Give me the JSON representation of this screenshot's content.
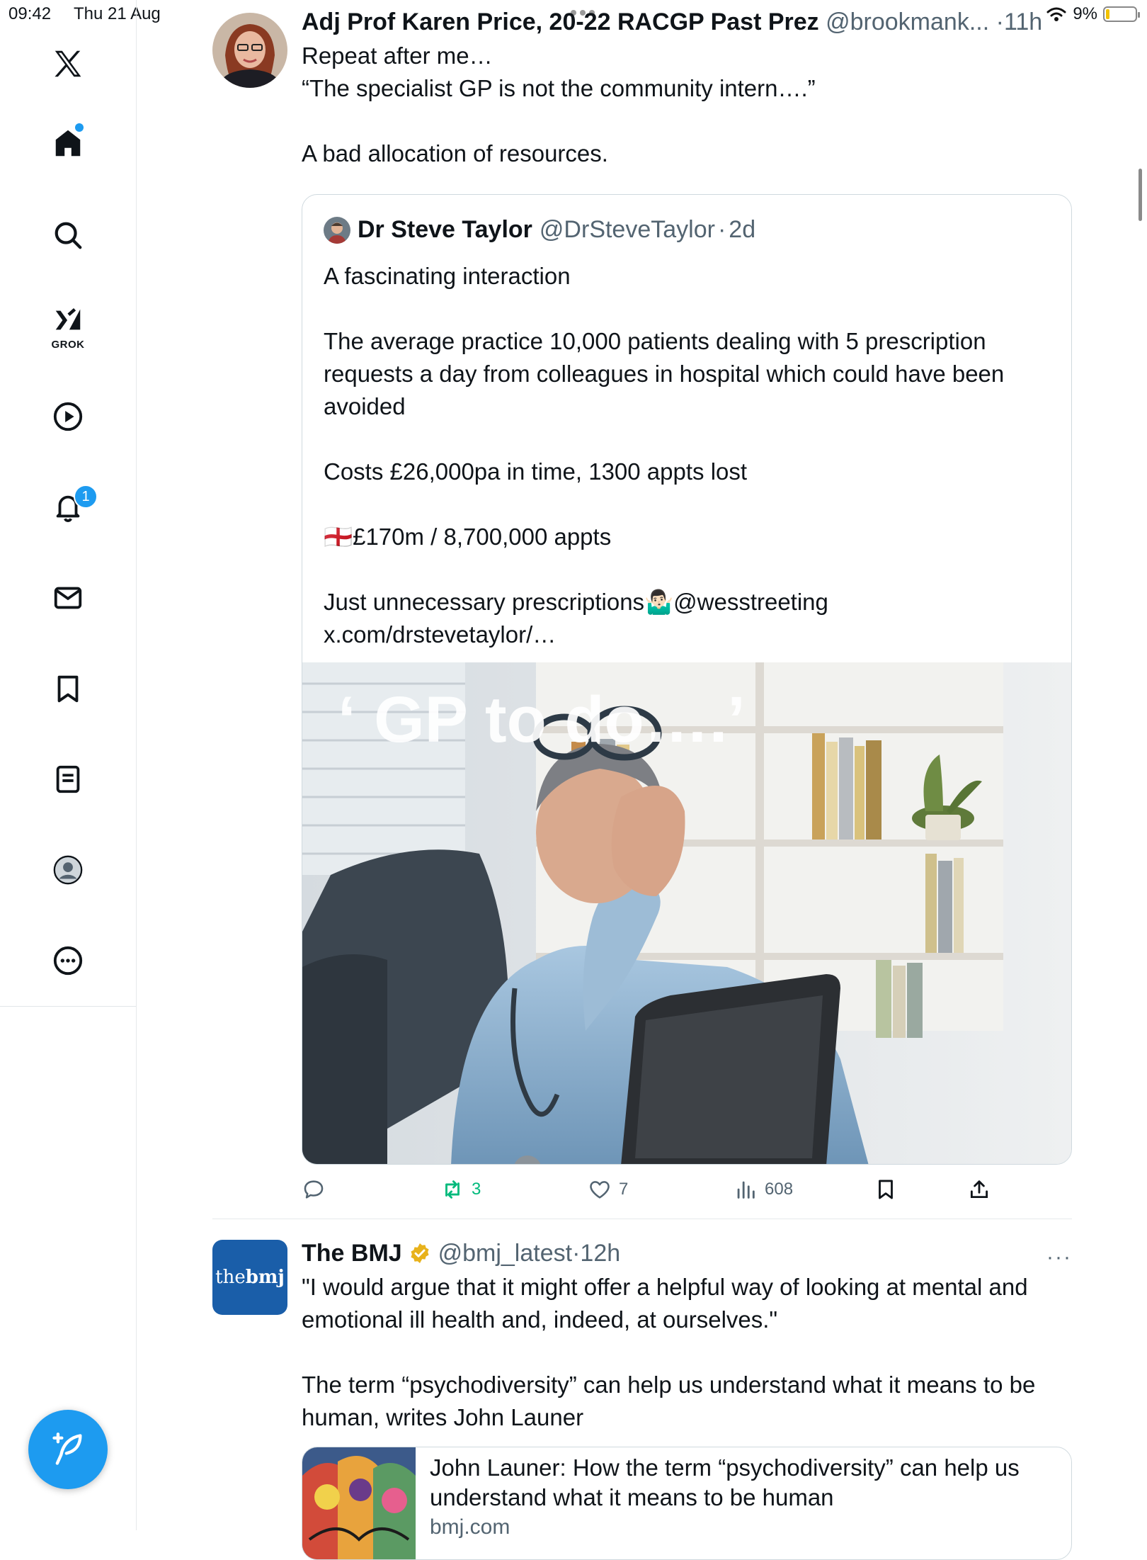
{
  "status_bar": {
    "time": "09:42",
    "date": "Thu 21 Aug",
    "battery": "9%"
  },
  "sidebar": {
    "items": [
      {
        "name": "home",
        "icon": "home-icon"
      },
      {
        "name": "search",
        "icon": "search-icon"
      },
      {
        "name": "grok",
        "icon": "grok-icon",
        "label": "GROK"
      },
      {
        "name": "video",
        "icon": "play-icon"
      },
      {
        "name": "notifications",
        "icon": "bell-icon",
        "badge": "1"
      },
      {
        "name": "messages",
        "icon": "mail-icon"
      },
      {
        "name": "bookmarks",
        "icon": "bookmark-icon"
      },
      {
        "name": "lists",
        "icon": "list-icon"
      },
      {
        "name": "profile",
        "icon": "profile-icon"
      },
      {
        "name": "more",
        "icon": "more-icon"
      }
    ],
    "compose_icon": "compose-icon",
    "accent": "#1d9bf0"
  },
  "tweet1": {
    "name": "Adj Prof Karen Price, 20-22 RACGP Past Prez",
    "handle": "@brookmank...",
    "sep": "·",
    "time": "11h",
    "text": "Repeat after me…\n“The specialist GP is not the community intern….”\n\nA bad allocation of resources.",
    "quote": {
      "name": "Dr Steve Taylor",
      "handle": "@DrSteveTaylor",
      "sep": "·",
      "time": "2d",
      "text": "A fascinating interaction\n\nThe average practice 10,000 patients dealing with 5 prescription requests a day from colleagues in hospital which could have been avoided\n\nCosts £26,000pa in time, 1300 appts lost\n\n🏴󠁧󠁢󠁥󠁮󠁧󠁿£170m / 8,700,000 appts\n\nJust unnecessary prescriptions🤷🏻‍♂️@wesstreeting x.com/drstevetaylor/…",
      "image_caption": "‘ GP to do….’"
    },
    "actions": {
      "reply": "",
      "retweets": "3",
      "likes": "7",
      "views": "608"
    },
    "retweet_color": "#00ba7c"
  },
  "tweet2": {
    "name": "The BMJ",
    "handle": "@bmj_latest",
    "sep": "·",
    "time": "12h",
    "more": "···",
    "logo_text_a": "the",
    "logo_text_b": "bmj",
    "text": "\"I would argue that it might offer a helpful way of looking at mental and emotional ill health and, indeed, at ourselves.\"\n\nThe term “psychodiversity” can help us understand what it means to be human, writes John Launer",
    "card": {
      "title": "John Launer: How the term “psychodiversity” can help us understand what it means to be human",
      "domain": "bmj.com"
    }
  }
}
